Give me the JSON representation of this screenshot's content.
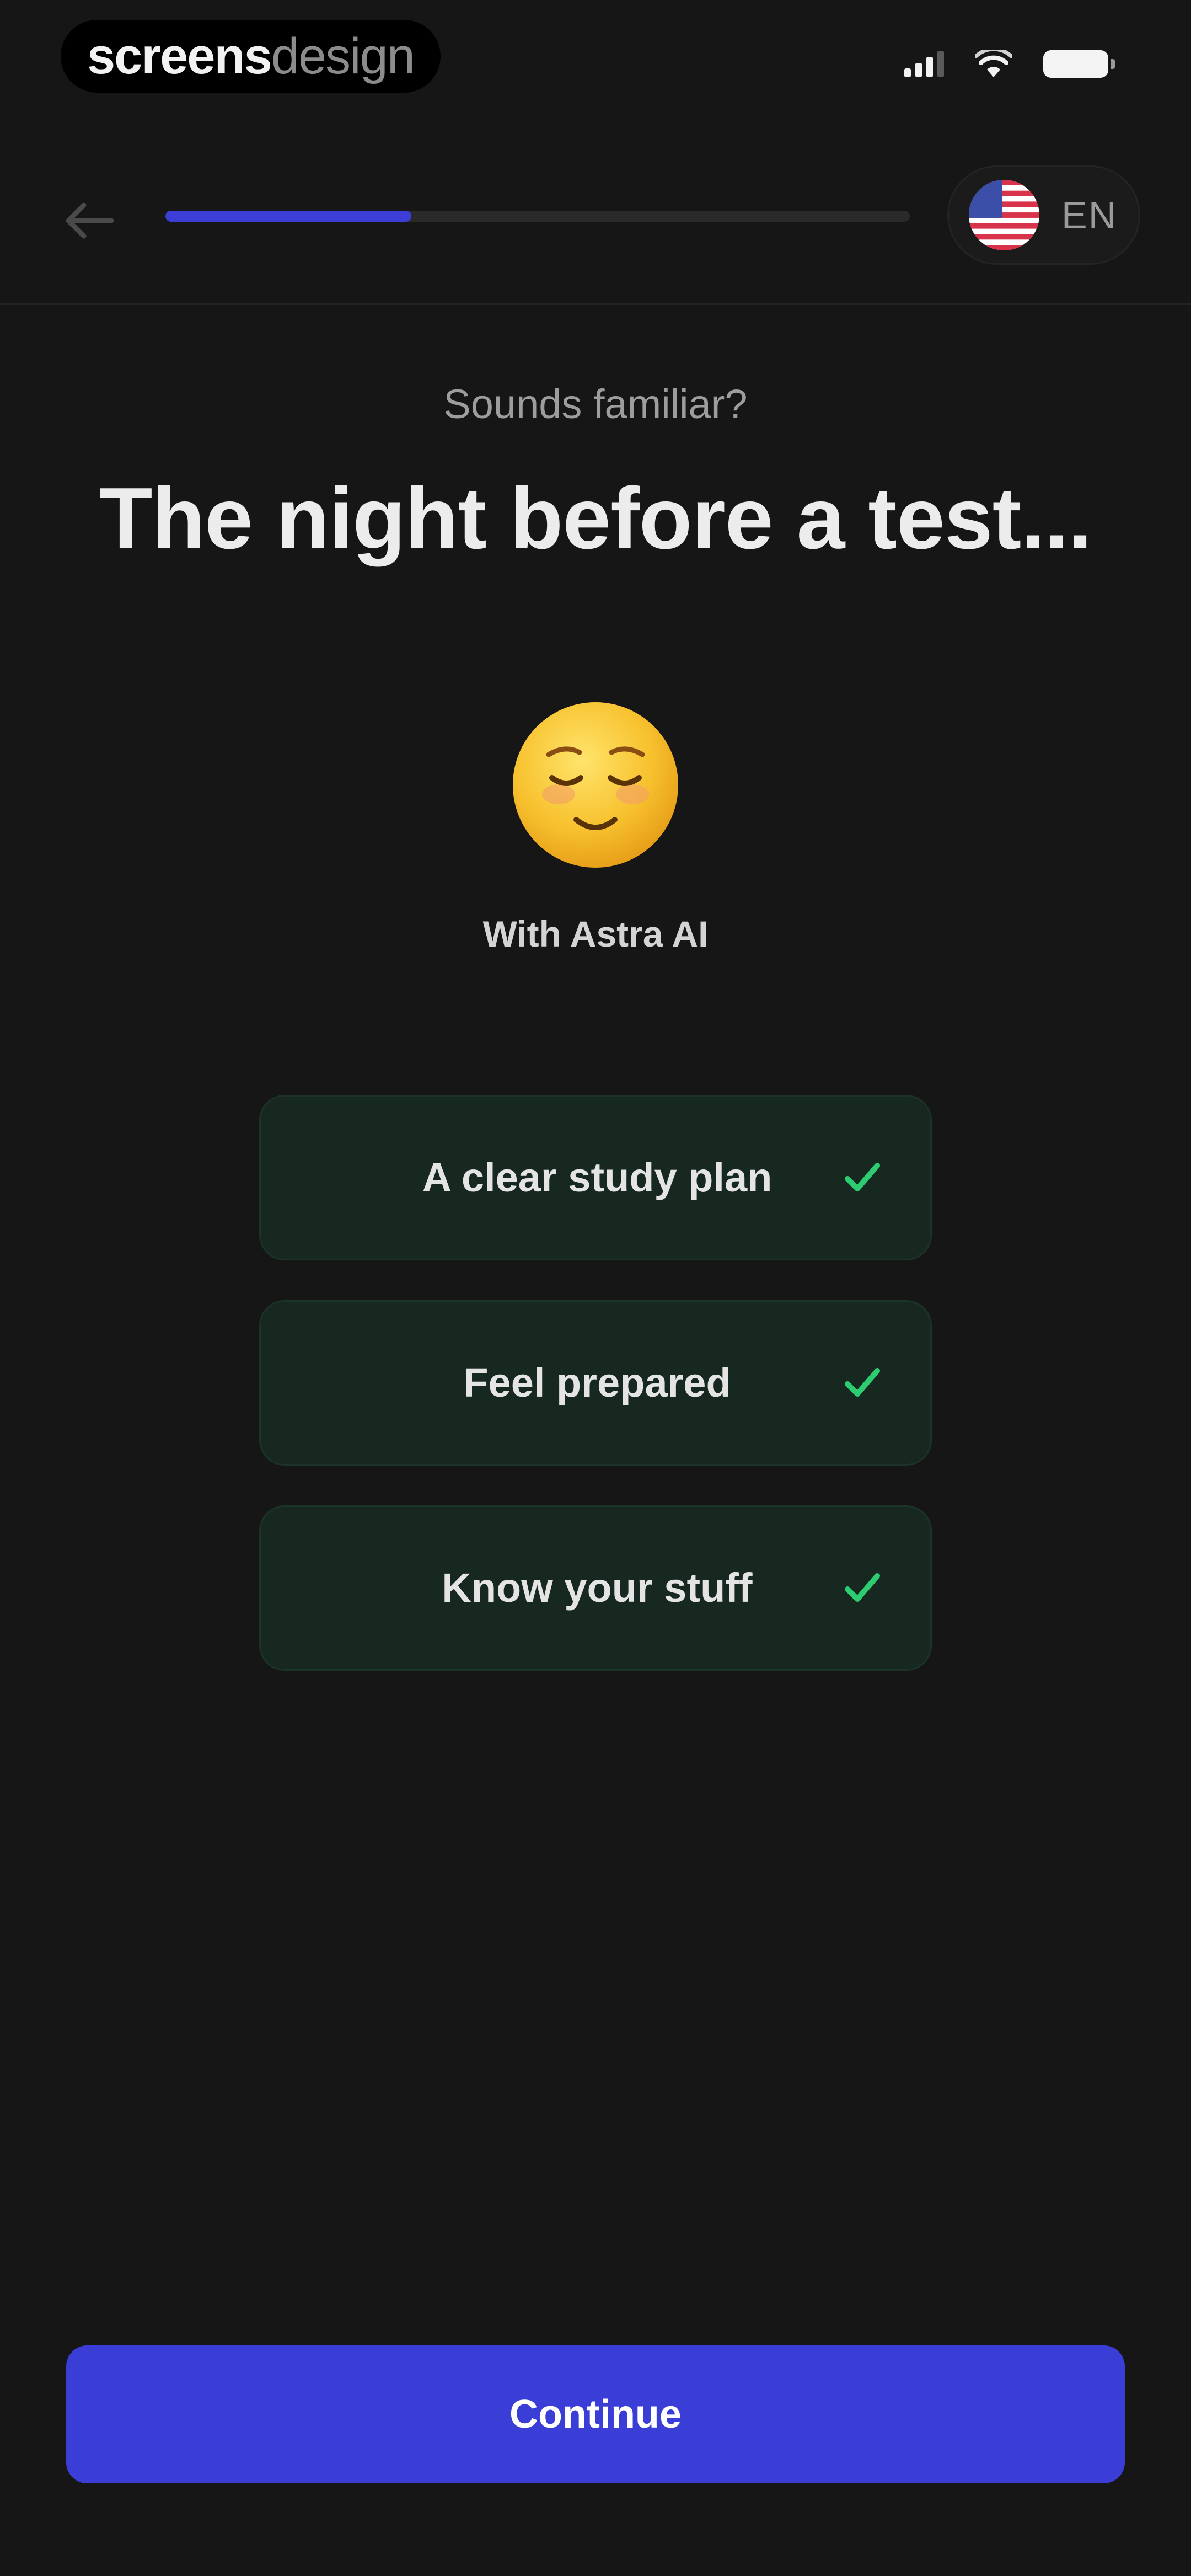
{
  "status_bar": {
    "watermark_primary": "screens",
    "watermark_secondary": "design",
    "icons": [
      "signal-icon",
      "wifi-icon",
      "battery-icon"
    ]
  },
  "header": {
    "back_icon": "arrow-left-icon",
    "progress_fraction": 0.33,
    "language": {
      "flag_icon": "us-flag-icon",
      "code": "EN"
    }
  },
  "main": {
    "eyebrow": "Sounds familiar?",
    "headline": "The night before a test...",
    "emoji_icon": "relieved-face-icon",
    "caption": "With Astra AI",
    "benefits": [
      {
        "label": "A clear study plan",
        "icon": "check-icon"
      },
      {
        "label": "Feel prepared",
        "icon": "check-icon"
      },
      {
        "label": "Know your stuff",
        "icon": "check-icon"
      }
    ]
  },
  "footer": {
    "continue_label": "Continue"
  },
  "colors": {
    "background": "#161616",
    "accent": "#3a3ed6",
    "card_background": "#16281f",
    "check": "#2ecc71"
  }
}
